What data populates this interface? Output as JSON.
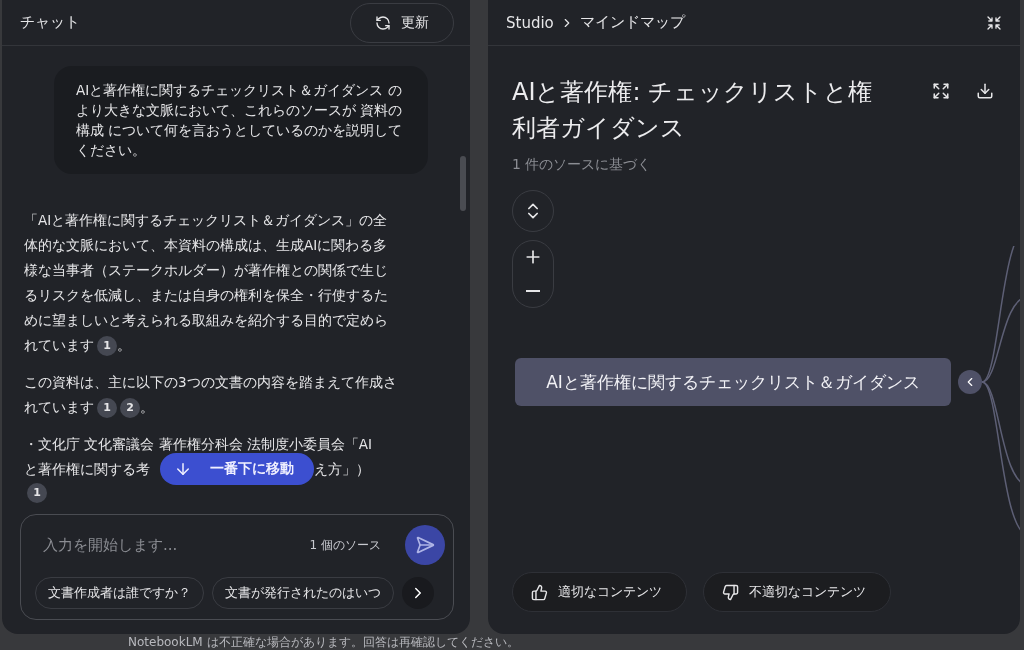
{
  "chat": {
    "title": "チャット",
    "refresh_button": "更新",
    "user_message": "AIと著作権に関するチェックリスト＆ガイダンス のより大きな文脈において、これらのソースが 資料の構成 について何を言おうとしているのかを説明してください。",
    "answer": {
      "paragraphs": [
        {
          "text": "「AIと著作権に関するチェックリスト＆ガイダンス」の全体的な文脈において、本資料の構成は、生成AIに関わる多様な当事者（ステークホルダー）が著作権との関係で生じるリスクを低減し、または自身の権利を保全・行使するために望ましいと考えられる取組みを紹介する目的で定められています",
          "citations": [
            "1"
          ],
          "end": "。"
        },
        {
          "text": "この資料は、主に以下の3つの文書の内容を踏まえて作成されています",
          "citations": [
            "1",
            "2"
          ],
          "end": "。"
        }
      ],
      "bullet": {
        "line_1": "・文化庁 文化審議会 著作権分科会 法制度小委員会「AI",
        "line_2_start": "と著作権に関する考",
        "line_2_end": "え方」）",
        "citations": [
          "1"
        ]
      }
    },
    "scroll_button": "一番下に移動",
    "input": {
      "placeholder": "入力を開始します...",
      "source_count": "1 個のソース"
    },
    "suggestions": [
      "文書作成者は誰ですか？",
      "文書が発行されたのはいつ"
    ]
  },
  "studio": {
    "breadcrumb": [
      "Studio",
      "マインドマップ"
    ],
    "title": "AIと著作権: チェックリストと権利者ガイダンス",
    "subtitle": "1 件のソースに基づく",
    "root_node": {
      "label": "AIと著作権に関するチェックリスト＆ガイダンス",
      "expanded": true
    },
    "feedback": [
      "適切なコンテンツ",
      "不適切なコンテンツ"
    ]
  },
  "footer": "NotebookLM は不正確な場合があります。回答は再確認してください。"
}
